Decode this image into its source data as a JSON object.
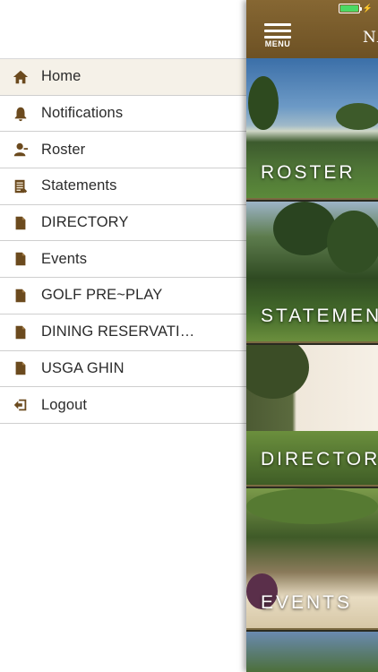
{
  "drawer": {
    "items": [
      {
        "label": "Home",
        "icon": "home-icon",
        "active": true
      },
      {
        "label": "Notifications",
        "icon": "bell-icon",
        "active": false
      },
      {
        "label": "Roster",
        "icon": "person-icon",
        "active": false
      },
      {
        "label": "Statements",
        "icon": "statement-icon",
        "active": false
      },
      {
        "label": "DIRECTORY",
        "icon": "document-icon",
        "active": false
      },
      {
        "label": "Events",
        "icon": "document-icon",
        "active": false
      },
      {
        "label": "GOLF PRE~PLAY",
        "icon": "document-icon",
        "active": false
      },
      {
        "label": "DINING RESERVATIONS",
        "icon": "document-icon",
        "active": false
      },
      {
        "label": "USGA GHIN",
        "icon": "document-icon",
        "active": false
      },
      {
        "label": "Logout",
        "icon": "logout-icon",
        "active": false
      }
    ]
  },
  "topbar": {
    "menu_label": "MENU",
    "brand_text": "NA",
    "battery_level": 1.0
  },
  "tiles": [
    {
      "label": "ROSTER"
    },
    {
      "label": "STATEMENTS"
    },
    {
      "label": "DIRECTORY"
    },
    {
      "label": "EVENTS"
    },
    {
      "label": ""
    }
  ],
  "colors": {
    "accent_brown": "#7b5e2c",
    "icon_brown": "#6b4a1e",
    "active_row_bg": "#f5f1e8",
    "battery_green": "#4cd964"
  }
}
